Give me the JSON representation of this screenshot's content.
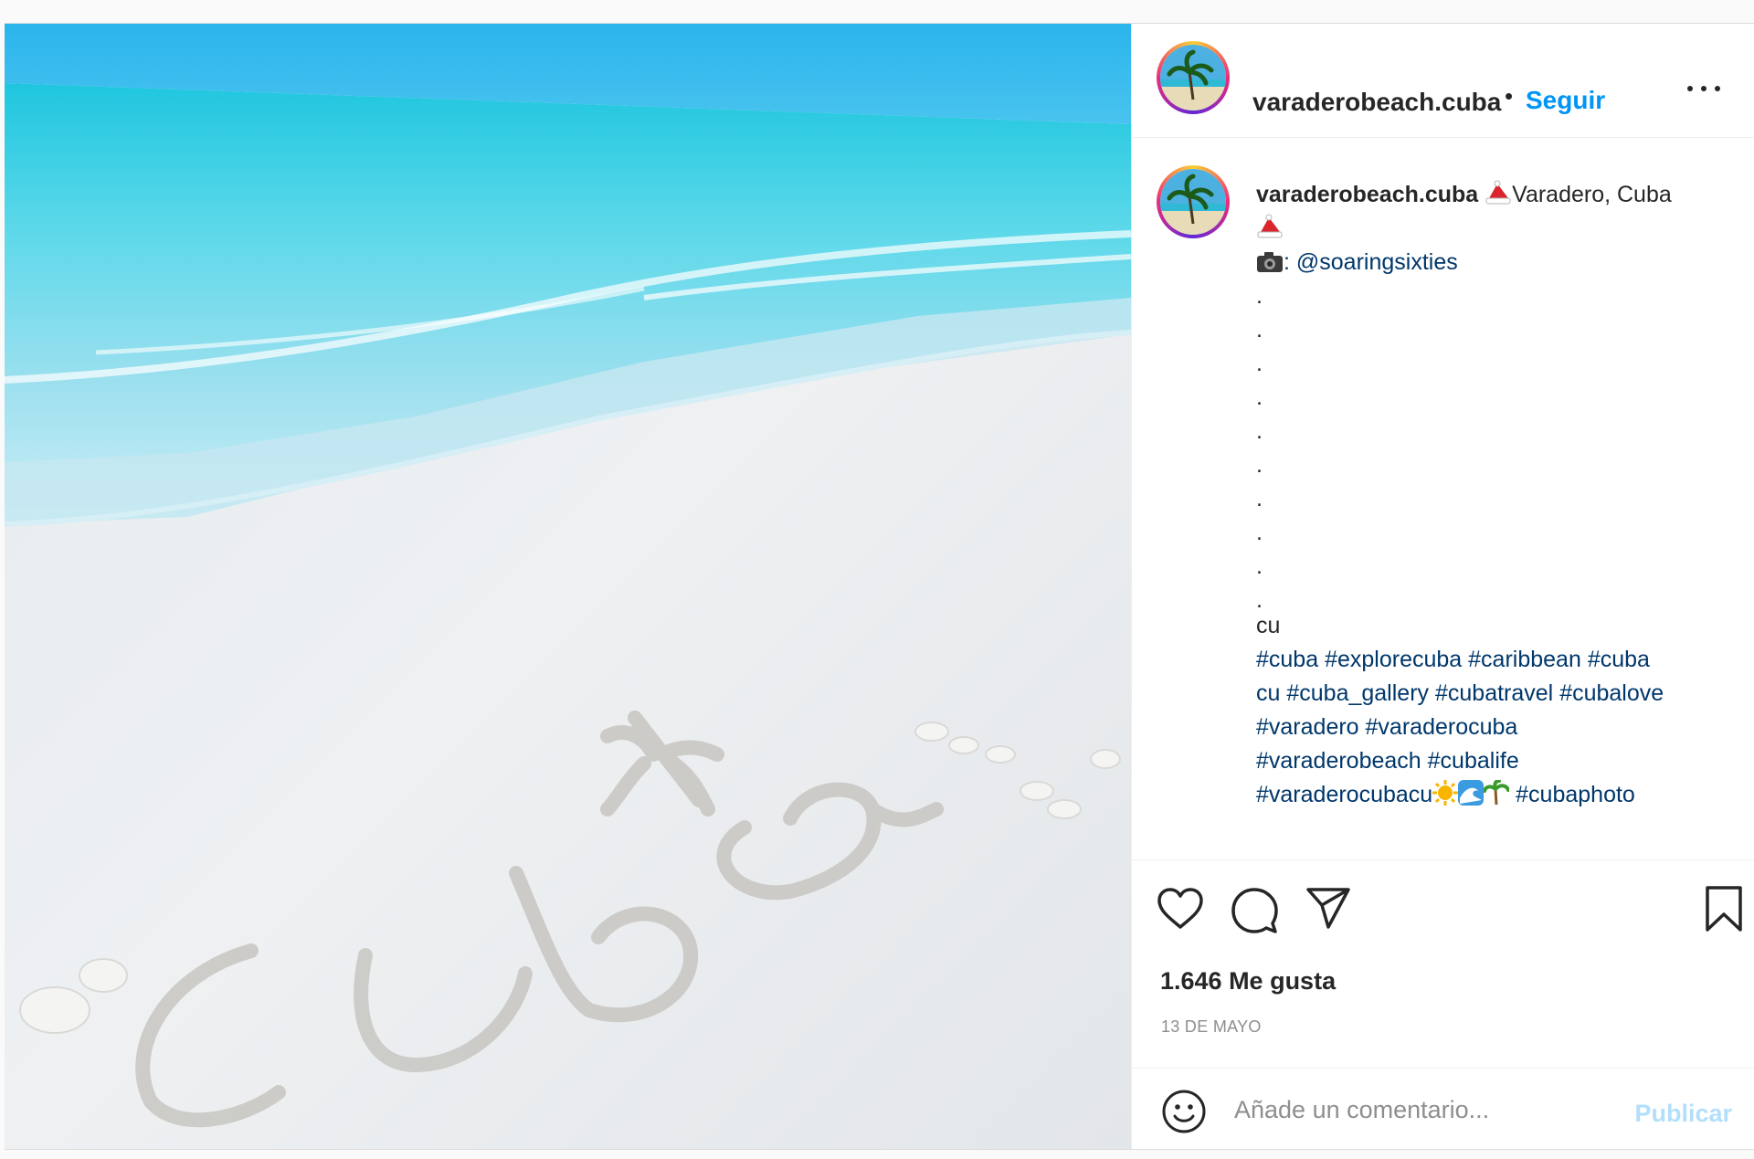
{
  "post": {
    "username": "varaderobeach.cuba",
    "follow_separator": "•",
    "follow_label": "Seguir",
    "more_icon": "more-horizontal-icon"
  },
  "caption": {
    "username": "varaderobeach.cuba",
    "location_text": "Varadero, Cuba",
    "photo_credit": ": @soaringsixties",
    "dots": [
      ".",
      ".",
      ".",
      ".",
      ".",
      ".",
      ".",
      ".",
      ".",
      "."
    ],
    "text_line": "cu",
    "hashtags": [
      "#cuba",
      "#explorecuba",
      "#caribbean",
      "#cuba",
      "cu",
      "#cuba_gallery",
      "#cubatravel",
      "#cubalove",
      "#varadero",
      "#varaderocuba",
      "#varaderobeach",
      "#cubalife",
      "#varaderocubacu"
    ],
    "final_hashtag": "#cubaphoto"
  },
  "image": {
    "sand_text": "cuba",
    "description_icon": "beach-photo"
  },
  "actions": {
    "like_icon": "heart-icon",
    "comment_icon": "comment-icon",
    "share_icon": "paper-plane-icon",
    "save_icon": "bookmark-icon"
  },
  "stats": {
    "likes": "1.646 Me gusta",
    "date": "13 DE MAYO"
  },
  "comment_box": {
    "emoji_icon": "smiley-icon",
    "placeholder": "Añade un comentario...",
    "publish_label": "Publicar"
  },
  "colors": {
    "link_blue": "#0095f6",
    "hashtag": "#00376b",
    "publish_disabled": "#b2dffc",
    "muted": "#8e8e8e"
  }
}
